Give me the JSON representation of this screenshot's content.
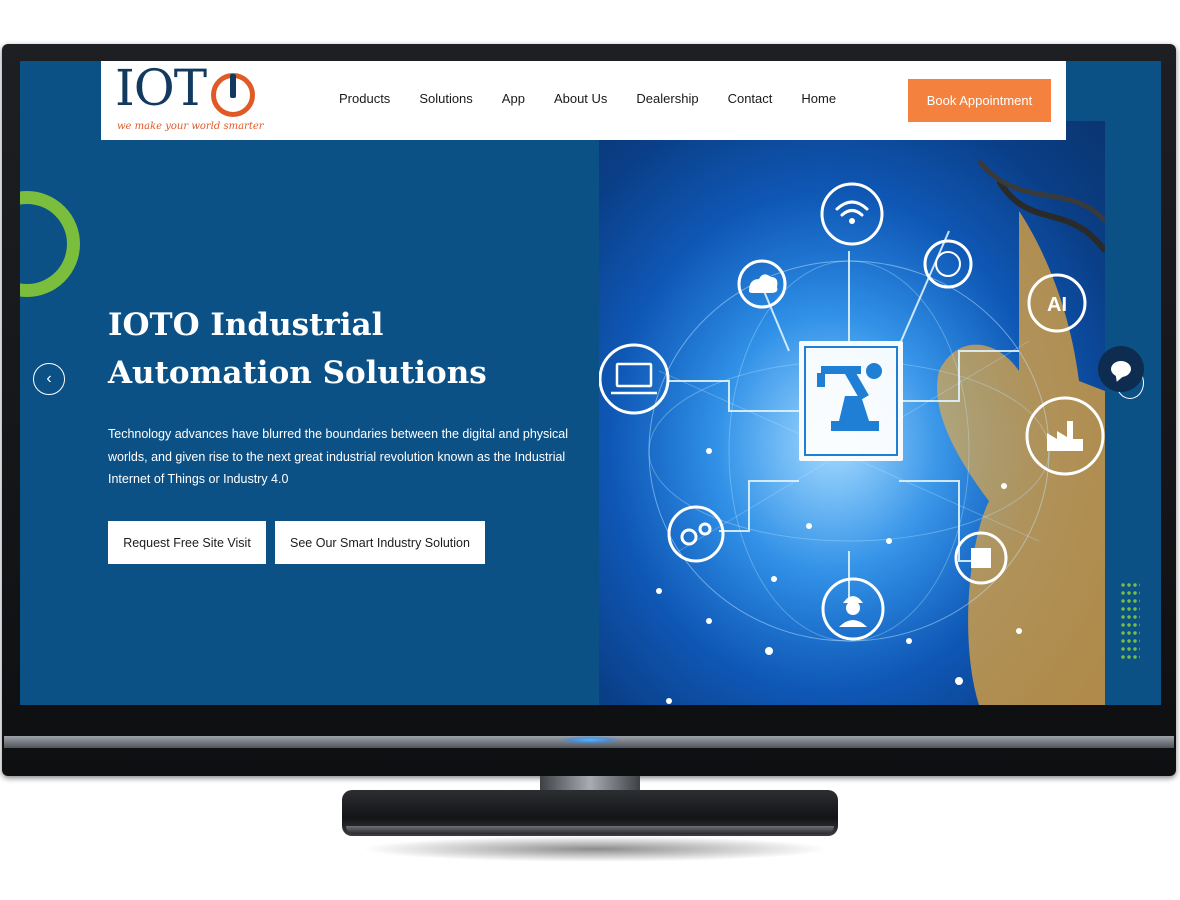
{
  "brand": {
    "logo_text": "IOTO",
    "tagline": "we make your world smarter"
  },
  "nav": {
    "items": [
      {
        "label": "Products"
      },
      {
        "label": "Solutions"
      },
      {
        "label": "App"
      },
      {
        "label": "About Us"
      },
      {
        "label": "Dealership"
      },
      {
        "label": "Contact"
      },
      {
        "label": "Home"
      }
    ],
    "cta_label": "Book Appointment"
  },
  "hero": {
    "title": "IOTO Industrial Automation Solutions",
    "description": "Technology advances have blurred the boundaries between the digital and physical worlds, and given rise to the next great industrial revolution known as the Industrial Internet of Things or Industry 4.0",
    "primary_button": "Request Free Site Visit",
    "secondary_button": "See Our Smart Industry Solution",
    "image_badge": "AI"
  },
  "slider": {
    "prev_icon": "chevron-left-icon",
    "next_icon": "chevron-right-icon"
  },
  "icons": {
    "chat": "chat-bubble-icon",
    "hero_nodes": [
      "wifi-icon",
      "cloud-icon",
      "globe-icon",
      "laptop-icon",
      "robot-arm-icon",
      "ai-icon",
      "factory-icon",
      "gears-icon",
      "chip-icon",
      "worker-icon"
    ]
  },
  "colors": {
    "hero_bg": "#0c5186",
    "accent": "#f4823e",
    "green": "#7bbd3d",
    "logo_navy": "#123a5e",
    "logo_orange": "#e05a28"
  }
}
